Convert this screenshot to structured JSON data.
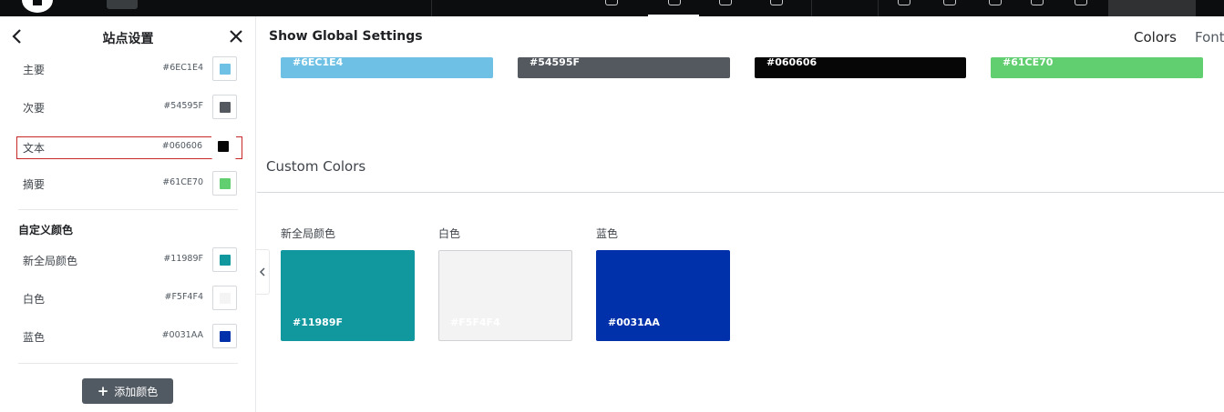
{
  "panel": {
    "title": "站点设置",
    "system_colors": [
      {
        "label": "主要",
        "hex": "#6EC1E4",
        "color": "#6EC1E4"
      },
      {
        "label": "次要",
        "hex": "#54595F",
        "color": "#54595F"
      },
      {
        "label": "文本",
        "hex": "#060606",
        "color": "#060606"
      },
      {
        "label": "摘要",
        "hex": "#61CE70",
        "color": "#61CE70"
      }
    ],
    "custom_section_title": "自定义颜色",
    "custom_colors": [
      {
        "label": "新全局颜色",
        "hex": "#11989F",
        "color": "#11989F"
      },
      {
        "label": "白色",
        "hex": "#F5F4F4",
        "color": "#F5F4F4"
      },
      {
        "label": "蓝色",
        "hex": "#0031AA",
        "color": "#0031AA"
      }
    ],
    "add_button_label": "添加颜色"
  },
  "content": {
    "title": "Show Global Settings",
    "tabs": [
      "Colors",
      "Font"
    ],
    "system_swatches": [
      {
        "hex": "#6EC1E4",
        "color": "#6EC1E4"
      },
      {
        "hex": "#54595F",
        "color": "#54595F"
      },
      {
        "hex": "#060606",
        "color": "#060606"
      },
      {
        "hex": "#61CE70",
        "color": "#61CE70"
      }
    ],
    "custom_title": "Custom Colors",
    "custom_swatches": [
      {
        "label": "新全局颜色",
        "hex": "#11989F",
        "color": "#11989F"
      },
      {
        "label": "白色",
        "hex": "#F5F4F4",
        "color": "#F5F4F4"
      },
      {
        "label": "蓝色",
        "hex": "#0031AA",
        "color": "#0031AA"
      }
    ]
  },
  "icons": {
    "back": "chevron-left-icon",
    "close": "close-icon",
    "add": "plus-icon",
    "collapse": "chevron-left-icon"
  }
}
